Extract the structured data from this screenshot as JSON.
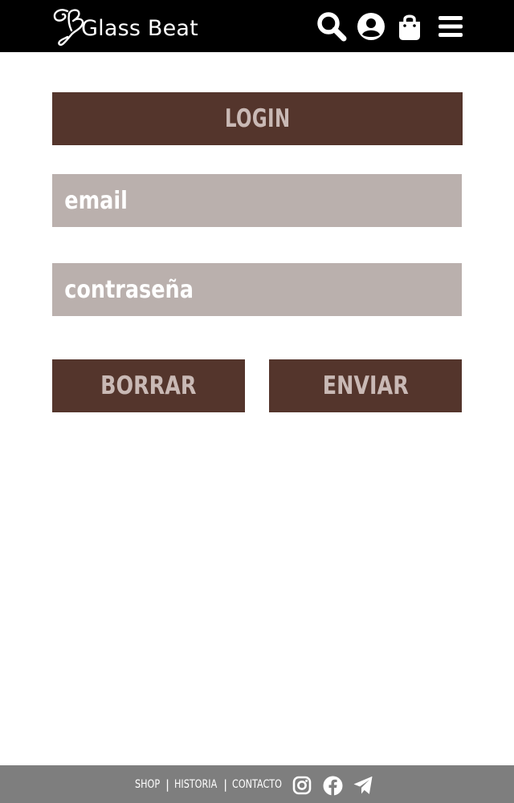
{
  "header": {
    "brand": "Glass Beat",
    "icons": [
      "search-icon",
      "user-icon",
      "shopping-bag-icon",
      "menu-icon"
    ]
  },
  "login": {
    "title": "LOGIN",
    "email_placeholder": "email",
    "password_placeholder": "contraseña",
    "clear_label": "BORRAR",
    "send_label": "ENVIAR"
  },
  "footer": {
    "links": [
      "SHOP",
      "HISTORIA",
      "CONTACTO"
    ],
    "separator": "|",
    "social_icons": [
      "instagram-icon",
      "facebook-icon",
      "telegram-icon"
    ]
  },
  "colors": {
    "header_bg": "#000000",
    "accent_brown": "#54352c",
    "button_text": "#c9b9b5",
    "field_bg": "#bab0ad",
    "footer_bg": "#7e7e7e"
  }
}
